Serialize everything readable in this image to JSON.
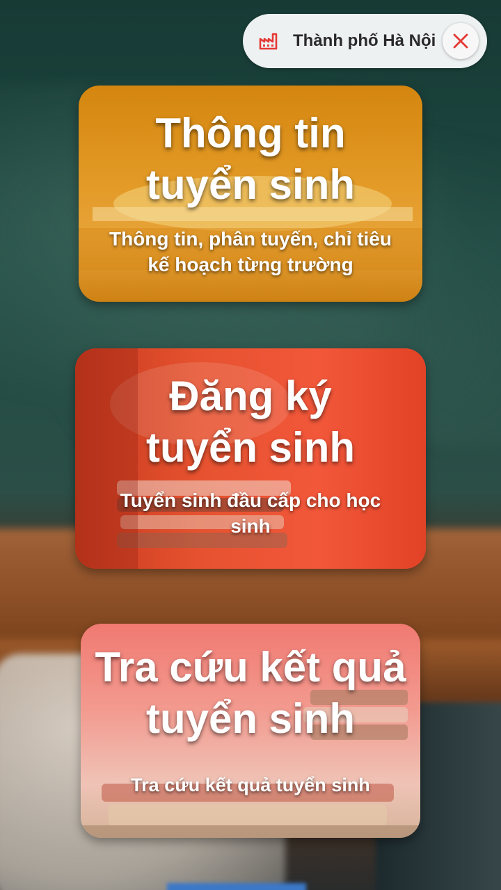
{
  "location_chip": {
    "icon": "factory-icon",
    "label": "Thành phố Hà Nội",
    "close_icon": "close-icon",
    "accent_color": "#e53935"
  },
  "cards": [
    {
      "title_line1": "Thông tin",
      "title_line2": "tuyển sinh",
      "subtitle_line1": "Thông tin, phân tuyến, chỉ tiêu",
      "subtitle_line2": "kế hoạch từng trường"
    },
    {
      "title_line1": "Đăng ký",
      "title_line2": "tuyển sinh",
      "subtitle_line1": "Tuyển sinh đầu cấp cho học",
      "subtitle_line2": "sinh"
    },
    {
      "title_line1": "Tra cứu kết quả",
      "title_line2": "tuyển sinh",
      "subtitle_line1": "Tra cứu kết quả tuyển sinh",
      "subtitle_line2": ""
    }
  ]
}
